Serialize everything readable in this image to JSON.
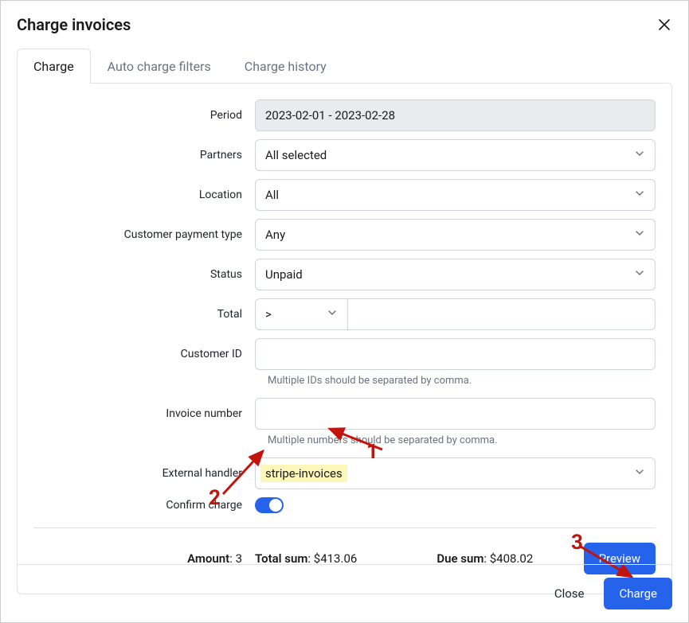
{
  "modal": {
    "title": "Charge invoices"
  },
  "tabs": [
    {
      "label": "Charge",
      "active": true
    },
    {
      "label": "Auto charge filters",
      "active": false
    },
    {
      "label": "Charge history",
      "active": false
    }
  ],
  "form": {
    "period_label": "Period",
    "period_value": "2023-02-01 - 2023-02-28",
    "partners_label": "Partners",
    "partners_value": "All selected",
    "location_label": "Location",
    "location_value": "All",
    "payment_type_label": "Customer payment type",
    "payment_type_value": "Any",
    "status_label": "Status",
    "status_value": "Unpaid",
    "total_label": "Total",
    "total_operator": ">",
    "total_value": "",
    "customer_id_label": "Customer ID",
    "customer_id_value": "",
    "customer_id_hint": "Multiple IDs should be separated by comma.",
    "invoice_number_label": "Invoice number",
    "invoice_number_value": "",
    "invoice_number_hint": "Multiple numbers should be separated by comma.",
    "external_handler_label": "External handler",
    "external_handler_value": "stripe-invoices",
    "confirm_charge_label": "Confirm charge",
    "confirm_charge_on": true
  },
  "summary": {
    "amount_label": "Amount",
    "amount_value": "3",
    "total_sum_label": "Total sum",
    "total_sum_value": "$413.06",
    "due_sum_label": "Due sum",
    "due_sum_value": "$408.02",
    "preview_label": "Preview"
  },
  "footer": {
    "close_label": "Close",
    "charge_label": "Charge"
  },
  "annotations": {
    "n1": "1",
    "n2": "2",
    "n3": "3"
  }
}
